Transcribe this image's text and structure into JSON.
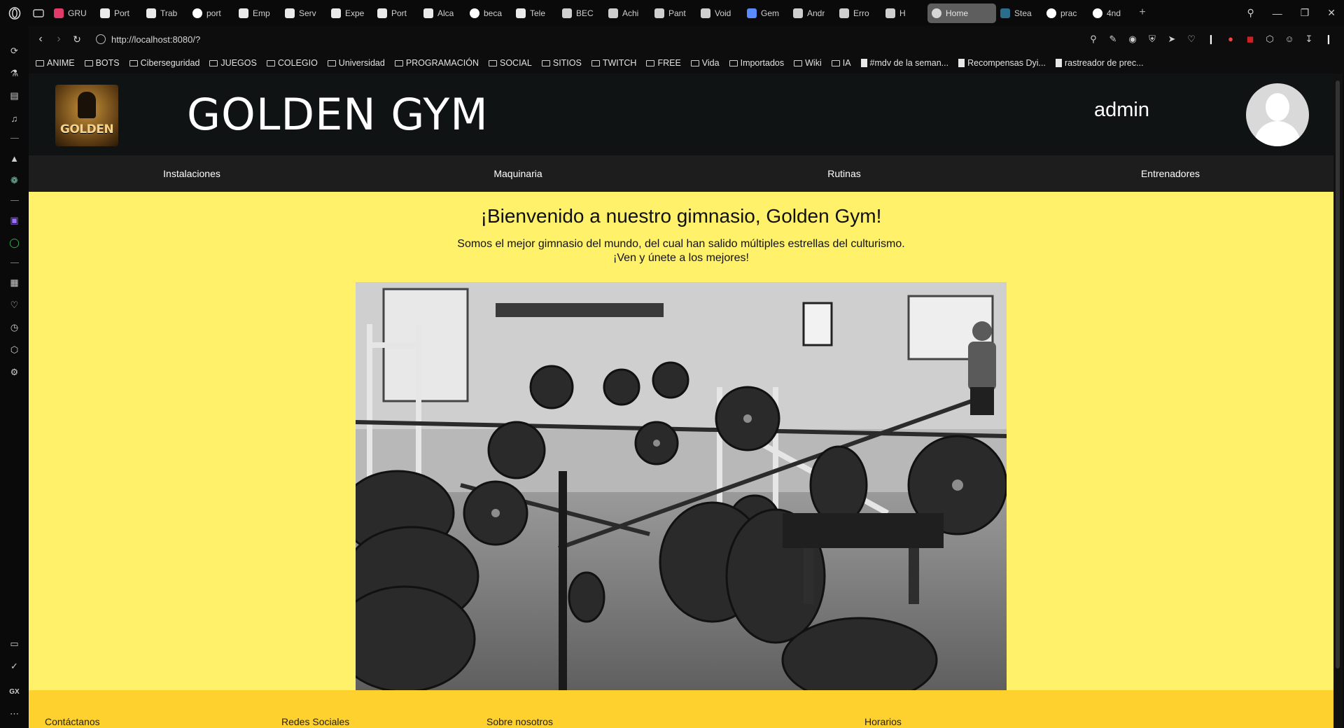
{
  "browser": {
    "tabs": [
      {
        "title": "GRU",
        "icon": "pinterest-like-icon"
      },
      {
        "title": "Port",
        "icon": "document-icon"
      },
      {
        "title": "Trab",
        "icon": "document-icon"
      },
      {
        "title": "port",
        "icon": "google-icon"
      },
      {
        "title": "Emp",
        "icon": "document-icon"
      },
      {
        "title": "Serv",
        "icon": "document-icon"
      },
      {
        "title": "Expe",
        "icon": "document-icon"
      },
      {
        "title": "Port",
        "icon": "document-icon"
      },
      {
        "title": "Alca",
        "icon": "document-icon"
      },
      {
        "title": "beca",
        "icon": "google-icon"
      },
      {
        "title": "Tele",
        "icon": "document-icon"
      },
      {
        "title": "BEC",
        "icon": "app-icon"
      },
      {
        "title": "Achi",
        "icon": "app-icon"
      },
      {
        "title": "Pant",
        "icon": "app-icon"
      },
      {
        "title": "Void",
        "icon": "app-icon"
      },
      {
        "title": "Gem",
        "icon": "gemini-icon"
      },
      {
        "title": "Andr",
        "icon": "app-icon"
      },
      {
        "title": "Erro",
        "icon": "app-icon"
      },
      {
        "title": "H",
        "icon": "app-icon"
      },
      {
        "title": "Home",
        "icon": "globe-icon",
        "active": true
      },
      {
        "title": "Stea",
        "icon": "steam-icon"
      },
      {
        "title": "prac",
        "icon": "github-icon"
      },
      {
        "title": "4nd",
        "icon": "github-icon"
      }
    ],
    "url": "http://localhost:8080/?",
    "bookmarks": [
      {
        "label": "ANIME",
        "type": "folder"
      },
      {
        "label": "BOTS",
        "type": "folder"
      },
      {
        "label": "Ciberseguridad",
        "type": "folder"
      },
      {
        "label": "JUEGOS",
        "type": "folder"
      },
      {
        "label": "COLEGIO",
        "type": "folder"
      },
      {
        "label": "Universidad",
        "type": "folder"
      },
      {
        "label": "PROGRAMACIÓN",
        "type": "folder"
      },
      {
        "label": "SOCIAL",
        "type": "folder"
      },
      {
        "label": "SITIOS",
        "type": "folder"
      },
      {
        "label": "TWITCH",
        "type": "folder"
      },
      {
        "label": "FREE",
        "type": "folder"
      },
      {
        "label": "Vida",
        "type": "folder"
      },
      {
        "label": "Importados",
        "type": "folder"
      },
      {
        "label": "Wiki",
        "type": "folder"
      },
      {
        "label": "IA",
        "type": "folder"
      },
      {
        "label": "#mdv de la seman...",
        "type": "page"
      },
      {
        "label": "Recompensas Dyi...",
        "type": "page"
      },
      {
        "label": "rastreador de prec...",
        "type": "page"
      }
    ],
    "sidebar_label": "GX"
  },
  "site": {
    "title": "GOLDEN GYM",
    "logo_text": "GOLDEN",
    "username": "admin",
    "nav": [
      "Instalaciones",
      "Maquinaria",
      "Rutinas",
      "Entrenadores"
    ],
    "welcome_heading": "¡Bienvenido a nuestro gimnasio, Golden Gym!",
    "welcome_line1": "Somos el mejor gimnasio del mundo, del cual han salido múltiples estrellas del culturismo.",
    "welcome_line2": "¡Ven y únete a los mejores!",
    "footer": {
      "contact": "Contáctanos",
      "social": "Redes Sociales",
      "about": "Sobre nosotros",
      "hours": "Horarios"
    }
  },
  "colors": {
    "page_bg": "#fff16a",
    "header_bg": "#101313",
    "nav_bg": "#1d1d1d",
    "footer_bg": "#ffd12e"
  }
}
